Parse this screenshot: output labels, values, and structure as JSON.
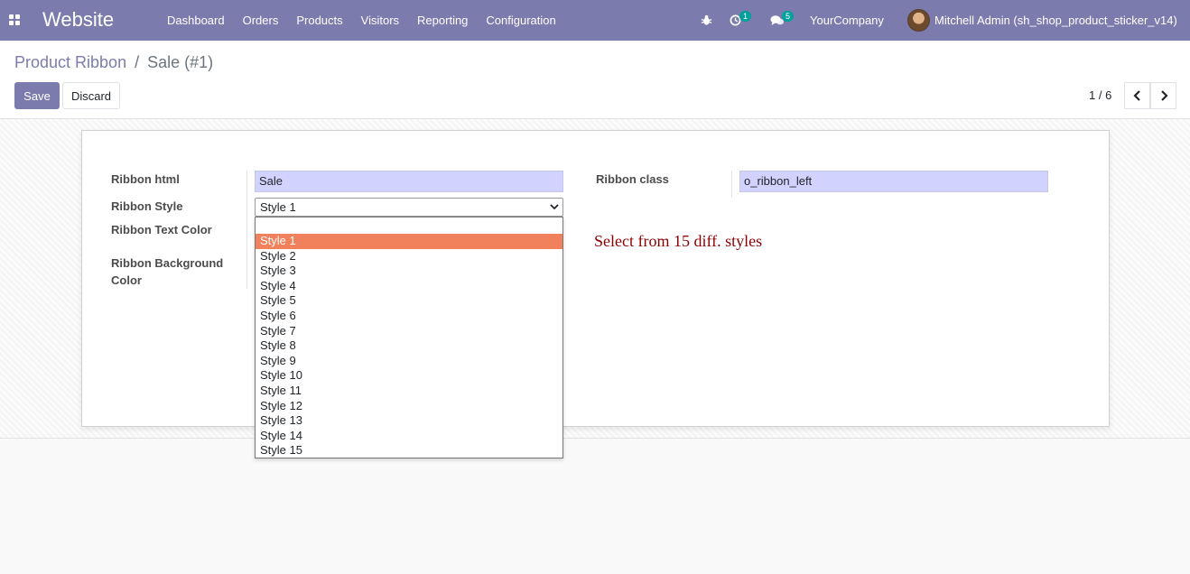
{
  "navbar": {
    "app_title": "Website",
    "menu": [
      "Dashboard",
      "Orders",
      "Products",
      "Visitors",
      "Reporting",
      "Configuration"
    ],
    "activity_count": "1",
    "messages_count": "5",
    "company": "YourCompany",
    "user": "Mitchell Admin (sh_shop_product_sticker_v14)"
  },
  "breadcrumb": {
    "parent": "Product Ribbon",
    "separator": "/",
    "current": "Sale (#1)"
  },
  "buttons": {
    "save": "Save",
    "discard": "Discard"
  },
  "pager": {
    "value": "1 / 6"
  },
  "form": {
    "ribbon_html_label": "Ribbon html",
    "ribbon_html_value": "Sale",
    "ribbon_style_label": "Ribbon Style",
    "ribbon_style_value": "Style 1",
    "ribbon_text_color_label": "Ribbon Text Color",
    "ribbon_bg_color_label_1": "Ribbon Background",
    "ribbon_bg_color_label_2": "Color",
    "ribbon_class_label": "Ribbon class",
    "ribbon_class_value": "o_ribbon_left"
  },
  "dropdown": {
    "options": [
      "Style 1",
      "Style 2",
      "Style 3",
      "Style 4",
      "Style 5",
      "Style 6",
      "Style 7",
      "Style 8",
      "Style 9",
      "Style 10",
      "Style 11",
      "Style 12",
      "Style 13",
      "Style 14",
      "Style 15"
    ],
    "selected_index": 0
  },
  "annotation": "Select from 15 diff. styles",
  "colors": {
    "navbar": "#7c7bad",
    "selected_option": "#f0815c",
    "annotation": "#8b0000",
    "required_field": "#d2d2ff"
  }
}
